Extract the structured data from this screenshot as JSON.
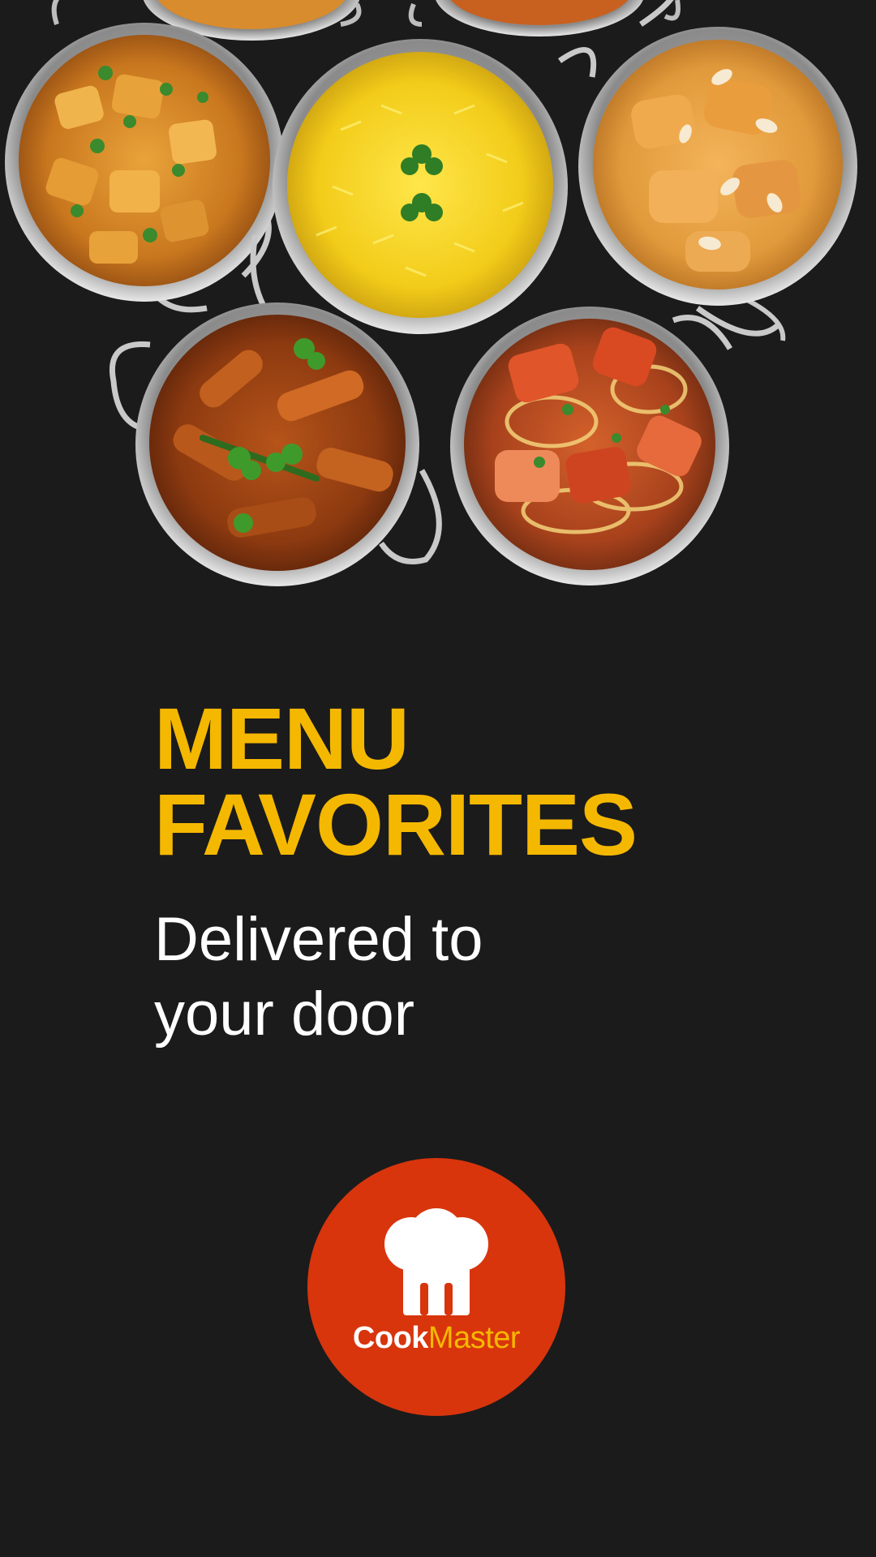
{
  "headline": {
    "line1": "MENU",
    "line2": "FAVORITES"
  },
  "subheadline": {
    "line1": "Delivered to",
    "line2": "your door"
  },
  "logo": {
    "word1": "Cook",
    "word2": "Master"
  },
  "hero_image": {
    "dishes": [
      "potato-curry",
      "saffron-rice",
      "chicken-korma",
      "jalfrezi-curry",
      "tandoori-chicken"
    ]
  },
  "colors": {
    "background": "#1b1b1b",
    "headline": "#f5b800",
    "subheadline": "#ffffff",
    "logo_badge": "#d8350d",
    "logo_accent": "#f5b800"
  }
}
